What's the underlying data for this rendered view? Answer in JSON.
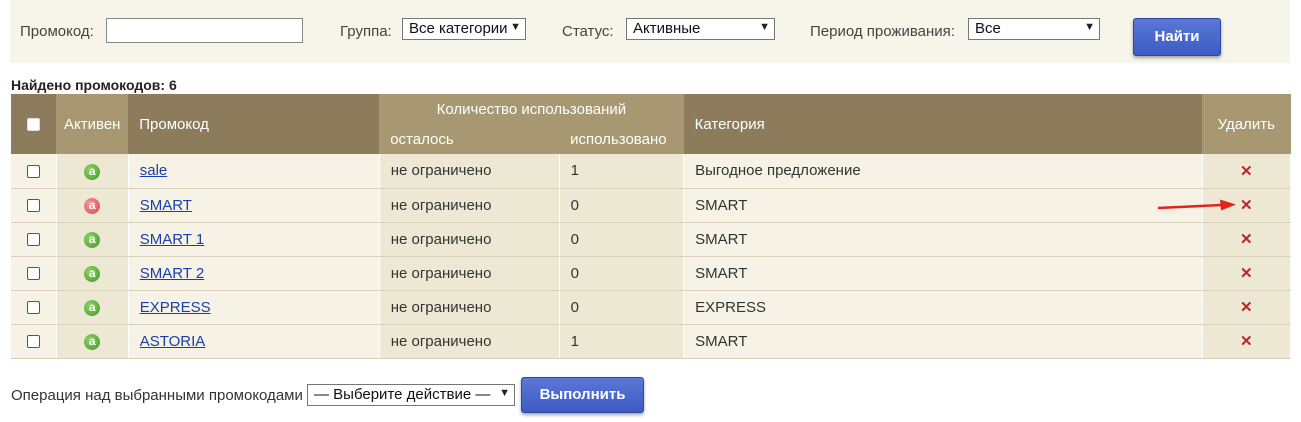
{
  "filters": {
    "promo_label": "Промокод:",
    "promo_value": "",
    "group_label": "Группа:",
    "group_value": "Все категории",
    "status_label": "Статус:",
    "status_value": "Активные",
    "period_label": "Период проживания:",
    "period_value": "Все",
    "find_button": "Найти"
  },
  "found_text": "Найдено промокодов: 6",
  "table": {
    "headers": {
      "active": "Активен",
      "promo": "Промокод",
      "usage_group": "Количество использований",
      "remaining": "осталось",
      "used": "использовано",
      "category": "Категория",
      "delete": "Удалить"
    },
    "rows": [
      {
        "active": true,
        "code": "sale",
        "remaining": "не ограничено",
        "used": "1",
        "category": "Выгодное предложение"
      },
      {
        "active": false,
        "code": "SMART",
        "remaining": "не ограничено",
        "used": "0",
        "category": "SMART"
      },
      {
        "active": true,
        "code": "SMART 1",
        "remaining": "не ограничено",
        "used": "0",
        "category": "SMART"
      },
      {
        "active": true,
        "code": "SMART 2",
        "remaining": "не ограничено",
        "used": "0",
        "category": "SMART"
      },
      {
        "active": true,
        "code": "EXPRESS",
        "remaining": "не ограничено",
        "used": "0",
        "category": "EXPRESS"
      },
      {
        "active": true,
        "code": "ASTORIA",
        "remaining": "не ограничено",
        "used": "1",
        "category": "SMART"
      }
    ],
    "badge_letter": "а",
    "delete_glyph": "✕"
  },
  "bulk": {
    "label": "Операция над выбранными промокодами",
    "select_value": "— Выберите действие —",
    "run_button": "Выполнить"
  },
  "colors": {
    "header_dark": "#8c7c5c",
    "header_light": "#a89872",
    "button_blue": "#4a68cf",
    "delete_red": "#d41c1c",
    "arrow_red": "#e0241c"
  }
}
